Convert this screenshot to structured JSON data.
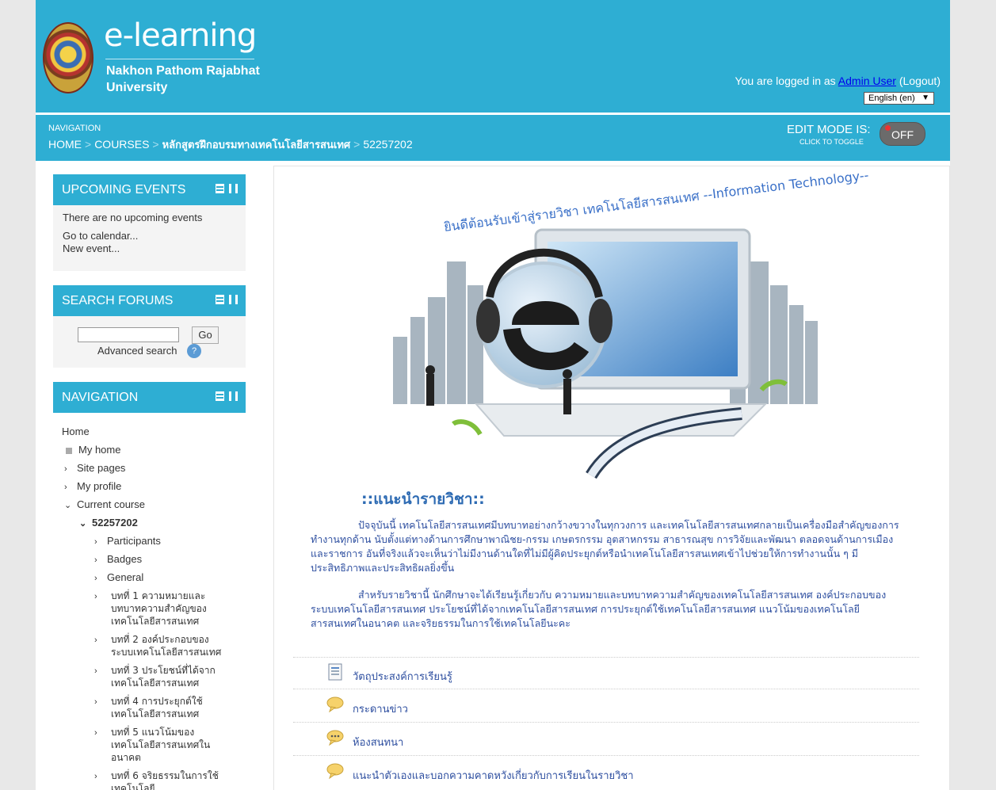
{
  "header": {
    "brand_title": "e-learning",
    "brand_sub1": "Nakhon Pathom Rajabhat",
    "brand_sub2": "University",
    "login_prefix": "You are logged in as ",
    "user_name": "Admin User",
    "logout_label": "Logout",
    "language": "English (en)",
    "language_arrow": "▼"
  },
  "navbar": {
    "label": "NAVIGATION",
    "breadcrumb": [
      "HOME",
      "COURSES",
      "หลักสูตรฝึกอบรมทางเทคโนโลยีสารสนเทศ",
      "52257202"
    ],
    "separator": ">",
    "edit_mode_label": "EDIT MODE IS:",
    "edit_mode_sub": "CLICK TO TOGGLE",
    "edit_mode_value": "OFF"
  },
  "blocks": {
    "events": {
      "title": "UPCOMING EVENTS",
      "empty_text": "There are no upcoming events",
      "calendar_link": "Go to calendar...",
      "new_event_link": "New event..."
    },
    "search": {
      "title": "SEARCH FORUMS",
      "go_label": "Go",
      "advanced_label": "Advanced search",
      "help_glyph": "?"
    },
    "navigation": {
      "title": "NAVIGATION",
      "home": "Home",
      "my_home": "My home",
      "site_pages": "Site pages",
      "my_profile": "My profile",
      "current_course": "Current course",
      "course_code": "52257202",
      "participants": "Participants",
      "badges": "Badges",
      "general": "General",
      "ch1": [
        "บทที่ 1 ความหมายและ",
        "บทบาทความสำคัญของ",
        "เทคโนโลยีสารสนเทศ"
      ],
      "ch2": [
        "บทที่ 2 องค์ประกอบของ",
        "ระบบเทคโนโลยีสารสนเทศ"
      ],
      "ch3": [
        "บทที่ 3 ประโยชน์ที่ได้จาก",
        "เทคโนโลยีสารสนเทศ"
      ],
      "ch4": [
        "บทที่ 4 การประยุกต์ใช้",
        "เทคโนโลยีสารสนเทศ"
      ],
      "ch5": [
        "บทที่ 5 แนวโน้มของ",
        "เทคโนโลยีสารสนเทศใน",
        "อนาคต"
      ],
      "ch6": [
        "บทที่ 6 จริยธรรมในการใช้",
        "เทคโนโลยี"
      ]
    }
  },
  "main": {
    "banner_caption": "ยินดีต้อนรับเข้าสู่รายวิชา เทคโนโลยีสารสนเทศ --Information Technology--",
    "intro_title": "::แนะนำรายวิชา::",
    "para1": "ปัจจุบันนี้ เทคโนโลยีสารสนเทศมีบทบาทอย่างกว้างขวางในทุกวงการ และเทคโนโลยีสารสนเทศกลายเป็นเครื่องมือสำคัญของการทำงานทุกด้าน นับตั้งแต่ทางด้านการศึกษาพาณิชย-กรรม เกษตรกรรม อุตสาหกรรม สาธารณสุข การวิจัยและพัฒนา ตลอดจนด้านการเมืองและราชการ อันที่จริงแล้วจะเห็นว่าไม่มีงานด้านใดที่ไม่มีผู้คิดประยุกต์หรือนำเทคโนโลยีสารสนเทศเข้าไปช่วยให้การทำงานนั้น ๆ มีประสิทธิภาพและประสิทธิผลยิ่งขึ้น",
    "para2": "สำหรับรายวิชานี้ นักศึกษาจะได้เรียนรู้เกี่ยวกับ ความหมายและบทบาทความสำคัญของเทคโนโลยีสารสนเทศ องค์ประกอบของระบบเทคโนโลยีสารสนเทศ ประโยชน์ที่ได้จากเทคโนโลยีสารสนเทศ การประยุกต์ใช้เทคโนโลยีสารสนเทศ แนวโน้มของเทคโนโลยีสารสนเทศในอนาคต และจริยธรรมในการใช้เทคโนโลยีนะคะ",
    "activities": [
      {
        "label": "วัตถุประสงค์การเรียนรู้",
        "icon": "page-icon"
      },
      {
        "label": "กระดานข่าว",
        "icon": "forum-icon"
      },
      {
        "label": "ห้องสนทนา",
        "icon": "chat-icon"
      },
      {
        "label": "แนะนำตัวเองและบอกความคาดหวังเกี่ยวกับการเรียนในรายวิชา",
        "icon": "forum-icon"
      }
    ]
  },
  "colors": {
    "brand_blue": "#2eaed3",
    "link_blue": "#2e4fa0",
    "title_blue": "#2e6bb3"
  }
}
